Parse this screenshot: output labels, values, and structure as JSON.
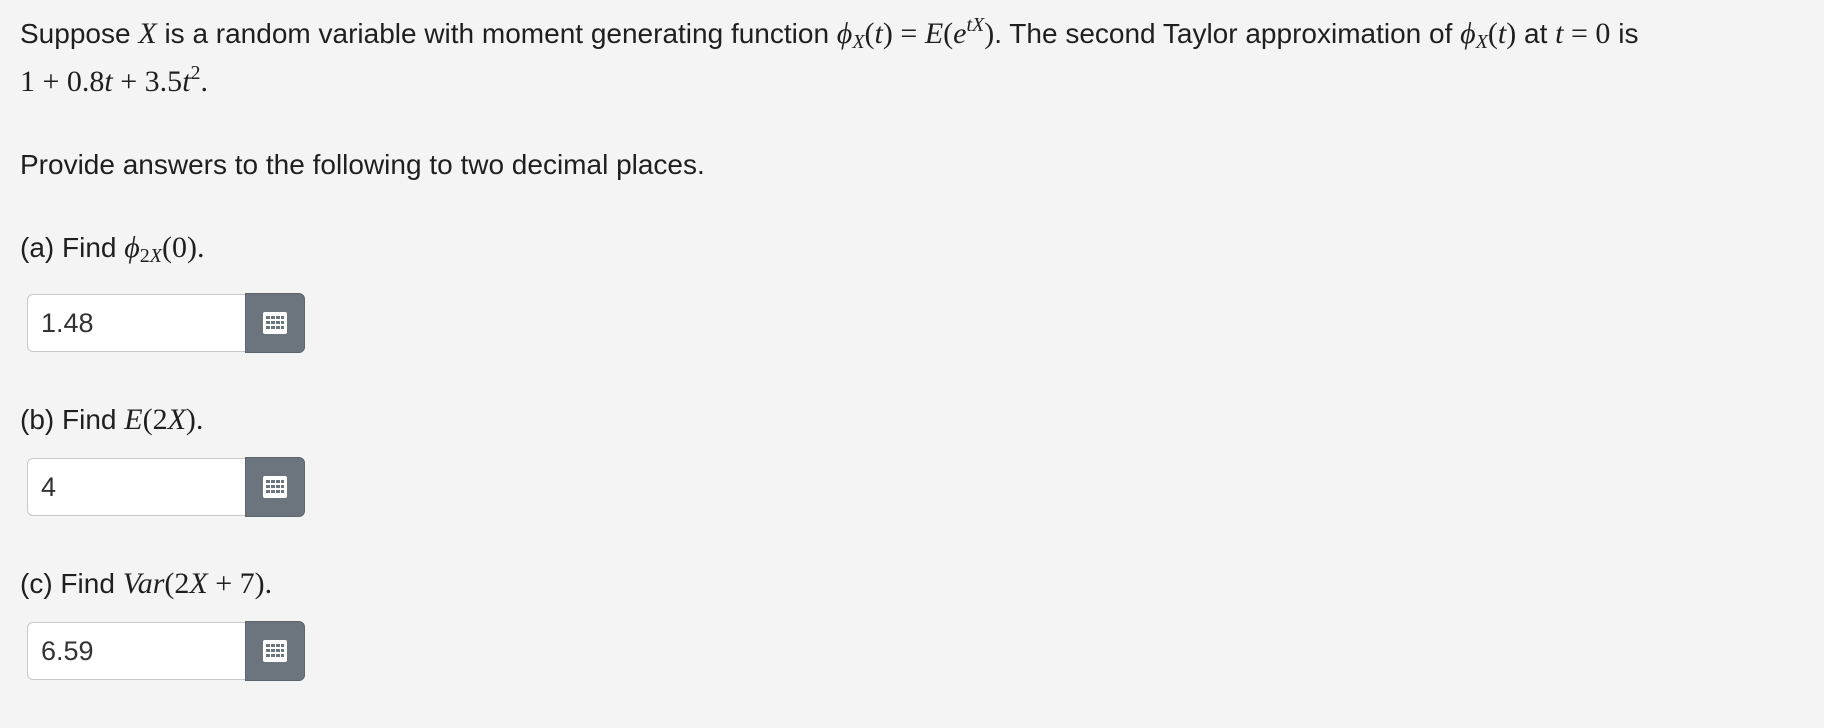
{
  "problem": {
    "intro_text_1": "Suppose ",
    "var_x": "X",
    "intro_text_2": " is a random variable with moment generating function ",
    "mgf_definition": "ϕX(t) = E(etX)",
    "intro_text_3": ". The second Taylor approximation of ",
    "mgf_symbol": "ϕX(t)",
    "intro_text_4": " at ",
    "at_point": "t = 0",
    "intro_text_5": " is",
    "taylor_approx": "1 + 0.8t + 3.5t2",
    "period": "."
  },
  "instructions": "Provide answers to the following to two decimal places.",
  "questions": [
    {
      "prefix": "(a) Find ",
      "expression": "ϕ2X(0)",
      "suffix": ".",
      "answer_value": "1.48"
    },
    {
      "prefix": "(b) Find ",
      "expression": "E(2X)",
      "suffix": ".",
      "answer_value": "4"
    },
    {
      "prefix": "(c) Find ",
      "expression": "Var(2X + 7)",
      "suffix": ".",
      "answer_value": "6.59"
    }
  ],
  "icons": {
    "keypad": "keypad-icon"
  },
  "colors": {
    "background": "#f4f4f4",
    "keypad_button": "#6c757d",
    "input_background": "#ffffff"
  }
}
